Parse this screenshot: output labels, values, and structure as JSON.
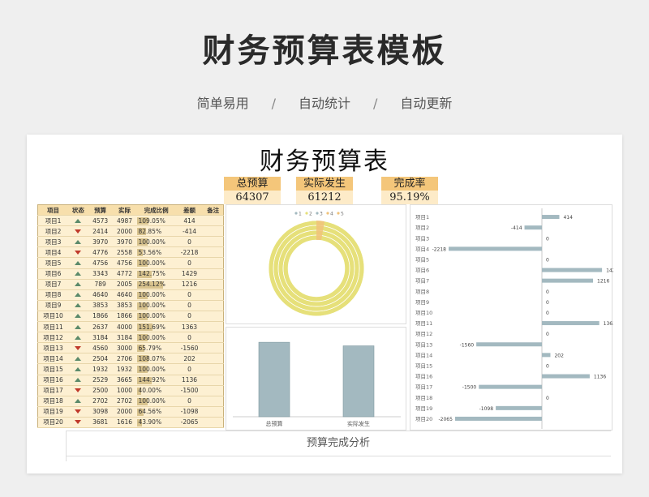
{
  "header": {
    "title": "财务预算表模板",
    "tags": [
      "简单易用",
      "自动统计",
      "自动更新"
    ],
    "separator": "/"
  },
  "sheet": {
    "title": "财务预算表",
    "kpis": [
      {
        "label": "总预算",
        "value": "64307"
      },
      {
        "label": "实际发生",
        "value": "61212"
      },
      {
        "label": "完成率",
        "value": "95.19%"
      }
    ],
    "table": {
      "columns": [
        "项目",
        "状态",
        "预算",
        "实际",
        "完成比例",
        "差额",
        "备注"
      ],
      "rows": [
        {
          "name": "项目1",
          "status": "up",
          "budget": "4573",
          "actual": "4987",
          "ratio": "109.05%",
          "diff": "414"
        },
        {
          "name": "项目2",
          "status": "down",
          "budget": "2414",
          "actual": "2000",
          "ratio": "82.85%",
          "diff": "-414"
        },
        {
          "name": "项目3",
          "status": "up",
          "budget": "3970",
          "actual": "3970",
          "ratio": "100.00%",
          "diff": "0"
        },
        {
          "name": "项目4",
          "status": "down",
          "budget": "4776",
          "actual": "2558",
          "ratio": "53.56%",
          "diff": "-2218"
        },
        {
          "name": "项目5",
          "status": "up",
          "budget": "4756",
          "actual": "4756",
          "ratio": "100.00%",
          "diff": "0"
        },
        {
          "name": "项目6",
          "status": "up",
          "budget": "3343",
          "actual": "4772",
          "ratio": "142.75%",
          "diff": "1429"
        },
        {
          "name": "项目7",
          "status": "up",
          "budget": "789",
          "actual": "2005",
          "ratio": "254.12%",
          "diff": "1216"
        },
        {
          "name": "项目8",
          "status": "up",
          "budget": "4640",
          "actual": "4640",
          "ratio": "100.00%",
          "diff": "0"
        },
        {
          "name": "项目9",
          "status": "up",
          "budget": "3853",
          "actual": "3853",
          "ratio": "100.00%",
          "diff": "0"
        },
        {
          "name": "项目10",
          "status": "up",
          "budget": "1866",
          "actual": "1866",
          "ratio": "100.00%",
          "diff": "0"
        },
        {
          "name": "项目11",
          "status": "up",
          "budget": "2637",
          "actual": "4000",
          "ratio": "151.69%",
          "diff": "1363"
        },
        {
          "name": "项目12",
          "status": "up",
          "budget": "3184",
          "actual": "3184",
          "ratio": "100.00%",
          "diff": "0"
        },
        {
          "name": "项目13",
          "status": "down",
          "budget": "4560",
          "actual": "3000",
          "ratio": "65.79%",
          "diff": "-1560"
        },
        {
          "name": "项目14",
          "status": "up",
          "budget": "2504",
          "actual": "2706",
          "ratio": "108.07%",
          "diff": "202"
        },
        {
          "name": "项目15",
          "status": "up",
          "budget": "1932",
          "actual": "1932",
          "ratio": "100.00%",
          "diff": "0"
        },
        {
          "name": "项目16",
          "status": "up",
          "budget": "2529",
          "actual": "3665",
          "ratio": "144.92%",
          "diff": "1136"
        },
        {
          "name": "项目17",
          "status": "down",
          "budget": "2500",
          "actual": "1000",
          "ratio": "40.00%",
          "diff": "-1500"
        },
        {
          "name": "项目18",
          "status": "up",
          "budget": "2702",
          "actual": "2702",
          "ratio": "100.00%",
          "diff": "0"
        },
        {
          "name": "项目19",
          "status": "down",
          "budget": "3098",
          "actual": "2000",
          "ratio": "64.56%",
          "diff": "-1098"
        },
        {
          "name": "项目20",
          "status": "down",
          "budget": "3681",
          "actual": "1616",
          "ratio": "43.90%",
          "diff": "-2065"
        }
      ]
    },
    "footer_title": "预算完成分析",
    "colors": {
      "bar": "#a3b9c0",
      "donut_main": "#e6e07a",
      "donut_accent": "#f0c27a",
      "kpi_label": "#f4c67a",
      "kpi_value": "#fdebc8",
      "up": "#5b8a6a",
      "down": "#c0392b"
    }
  },
  "chart_data": [
    {
      "type": "pie",
      "legend": [
        "1",
        "2",
        "3",
        "4",
        "5"
      ],
      "legend_position": "top"
    },
    {
      "type": "bar",
      "categories": [
        "总预算",
        "实际发生"
      ],
      "values": [
        64307,
        61212
      ]
    },
    {
      "type": "bar",
      "orientation": "horizontal",
      "categories": [
        "项目1",
        "项目2",
        "项目3",
        "项目4",
        "项目5",
        "项目6",
        "项目7",
        "项目8",
        "项目9",
        "项目10",
        "项目11",
        "项目12",
        "项目13",
        "项目14",
        "项目15",
        "项目16",
        "项目17",
        "项目18",
        "项目19",
        "项目20"
      ],
      "values": [
        414,
        -414,
        0,
        -2218,
        0,
        1429,
        1216,
        0,
        0,
        0,
        1363,
        0,
        -1560,
        202,
        0,
        1136,
        -1500,
        0,
        -1098,
        -2065
      ]
    }
  ]
}
